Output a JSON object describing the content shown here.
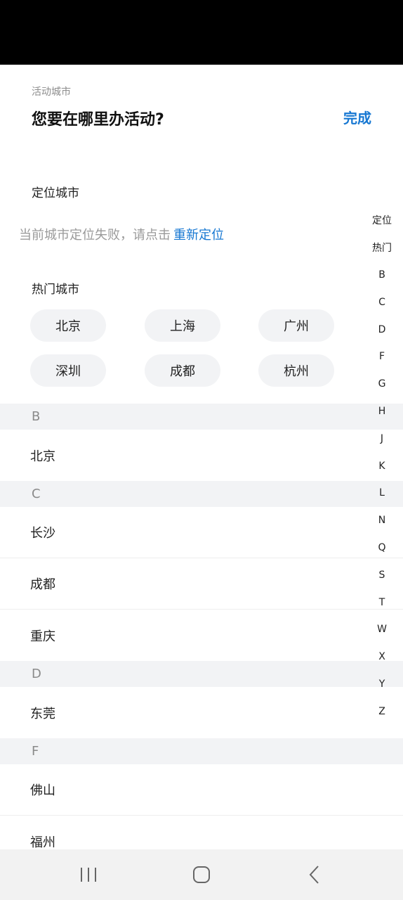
{
  "header": {
    "subtitle": "活动城市",
    "title": "您要在哪里办活动?",
    "done_label": "完成"
  },
  "location": {
    "section_label": "定位城市",
    "fail_message": "当前城市定位失败，请点击",
    "relocate_label": "重新定位"
  },
  "hot": {
    "section_label": "热门城市",
    "cities": [
      "北京",
      "上海",
      "广州",
      "深圳",
      "成都",
      "杭州"
    ]
  },
  "groups": [
    {
      "letter": "B",
      "cities": [
        "北京"
      ]
    },
    {
      "letter": "C",
      "cities": [
        "长沙",
        "成都",
        "重庆"
      ]
    },
    {
      "letter": "D",
      "cities": [
        "东莞"
      ]
    },
    {
      "letter": "F",
      "cities": [
        "佛山",
        "福州"
      ]
    }
  ],
  "index_bar": [
    "定位",
    "热门",
    "B",
    "C",
    "D",
    "F",
    "G",
    "H",
    "J",
    "K",
    "L",
    "N",
    "Q",
    "S",
    "T",
    "W",
    "X",
    "Y",
    "Z"
  ],
  "nav": {
    "icons": [
      "recent-apps-icon",
      "home-icon",
      "back-icon"
    ]
  },
  "colors": {
    "accent": "#1677d2",
    "group_bg": "#f2f3f5",
    "chip_bg": "#f2f3f5"
  }
}
